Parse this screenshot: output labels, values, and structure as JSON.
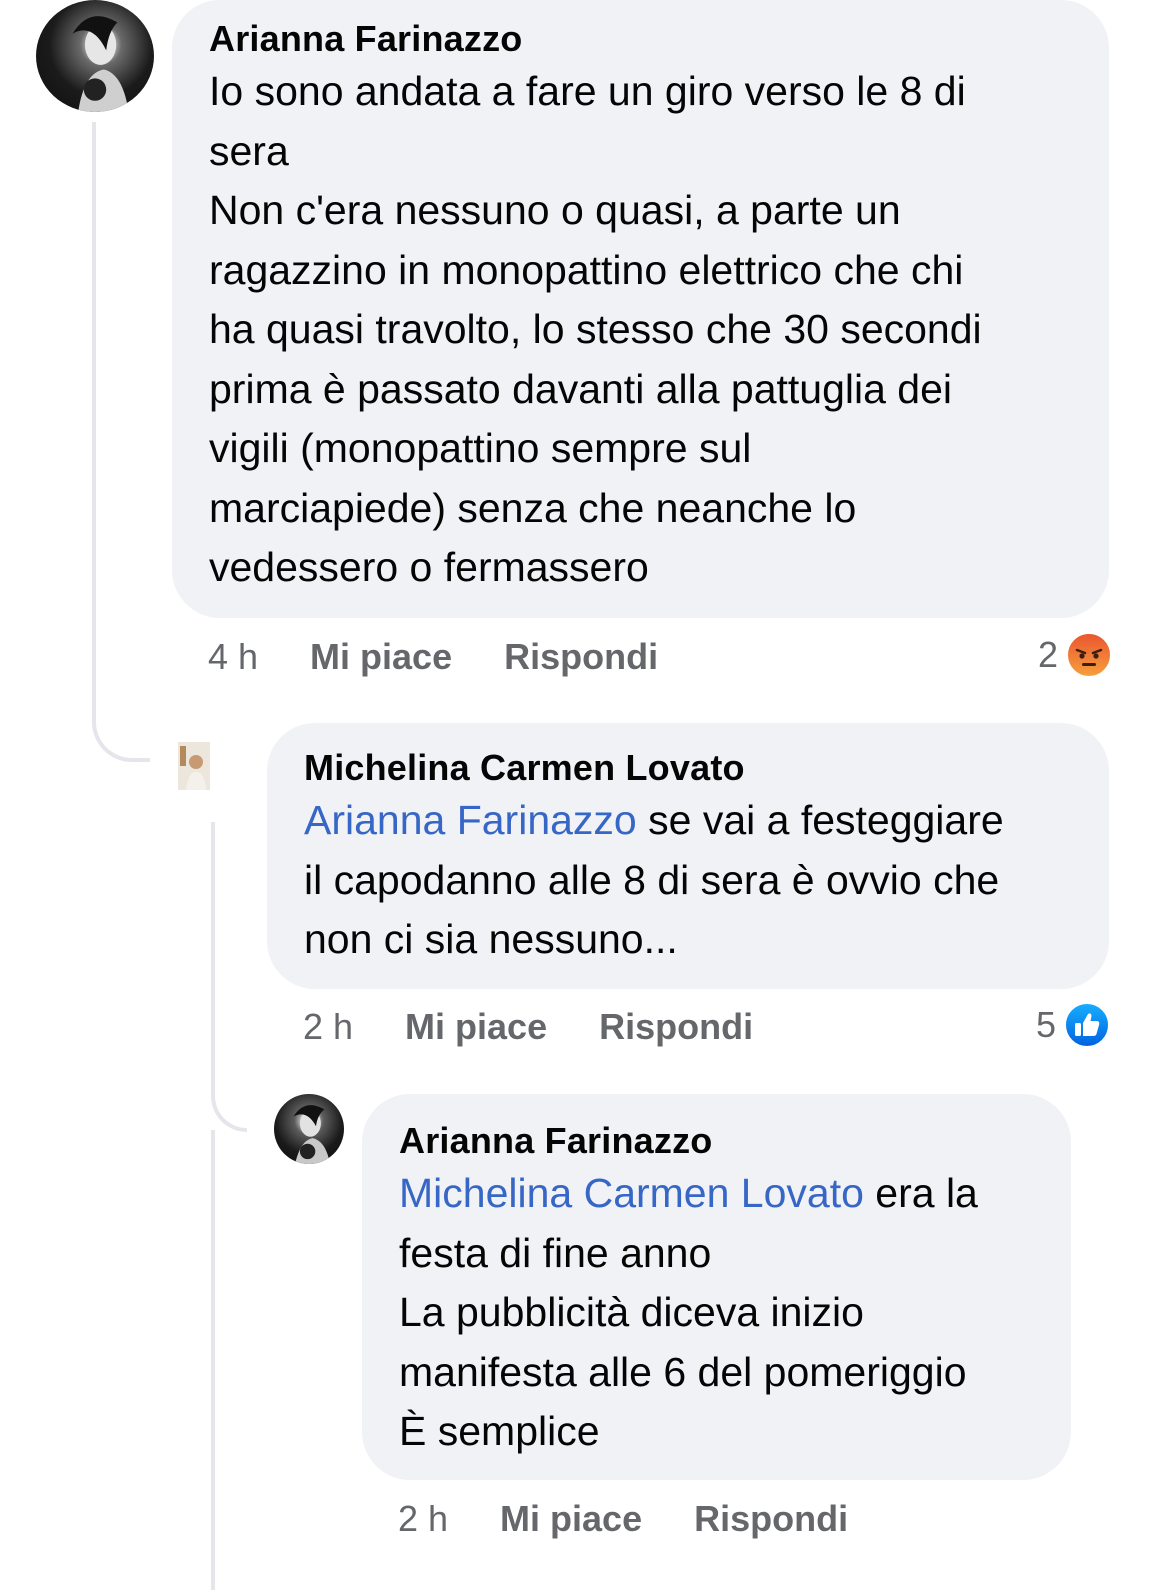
{
  "comments": [
    {
      "author": "Arianna Farinazzo",
      "text": "Io sono andata a fare un giro verso le 8 di\nsera\nNon c'era nessuno o quasi, a parte un\nragazzino in monopattino elettrico che chi\nha quasi travolto, lo stesso che 30 secondi\nprima è passato davanti alla pattuglia dei\nvigili (monopattino sempre sul\nmarciapiede) senza che neanche lo\nvedessero o fermassero",
      "time": "4 h",
      "like_label": "Mi piace",
      "reply_label": "Rispondi",
      "reaction_count": "2",
      "reaction_type": "angry"
    },
    {
      "author": "Michelina Carmen Lovato",
      "mention": "Arianna Farinazzo",
      "text_after_mention": " se vai a festeggiare\nil capodanno alle 8 di sera è ovvio che\nnon ci sia nessuno...",
      "time": "2 h",
      "like_label": "Mi piace",
      "reply_label": "Rispondi",
      "reaction_count": "5",
      "reaction_type": "like"
    },
    {
      "author": "Arianna Farinazzo",
      "mention": "Michelina Carmen Lovato",
      "text_after_mention": " era la\nfesta di fine anno\nLa pubblicità diceva inizio\nmanifesta alle 6 del pomeriggio\nÈ semplice",
      "time": "2 h",
      "like_label": "Mi piace",
      "reply_label": "Rispondi"
    }
  ],
  "colors": {
    "bubble": "#f0f2f5",
    "mention": "#3767c6",
    "meta": "#65676b",
    "like_blue": "#1877f2",
    "angry_orange": "#f0773a"
  },
  "icons": {
    "angry": "angry-reaction-icon",
    "like": "like-reaction-icon"
  }
}
